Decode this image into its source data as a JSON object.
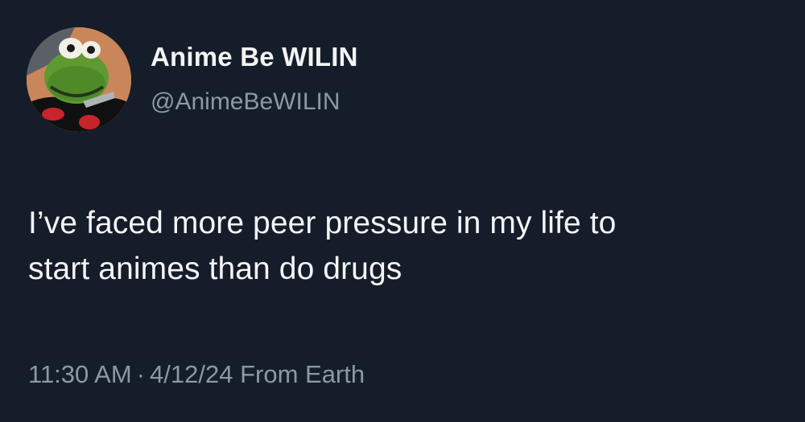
{
  "author": {
    "display_name": "Anime Be WILIN",
    "handle": "@AnimeBeWILIN",
    "avatar_icon": "kermit-akatsuki-avatar"
  },
  "tweet": {
    "text_line1": "I’ve faced more peer pressure in my life to",
    "text_line2": "start animes than do drugs"
  },
  "meta": {
    "time": "11:30 AM",
    "separator": "·",
    "date": "4/12/24",
    "source": "From Earth"
  },
  "colors": {
    "background": "#141d29",
    "primary_text": "#e7e9ea",
    "secondary_text": "#8b98a5"
  }
}
